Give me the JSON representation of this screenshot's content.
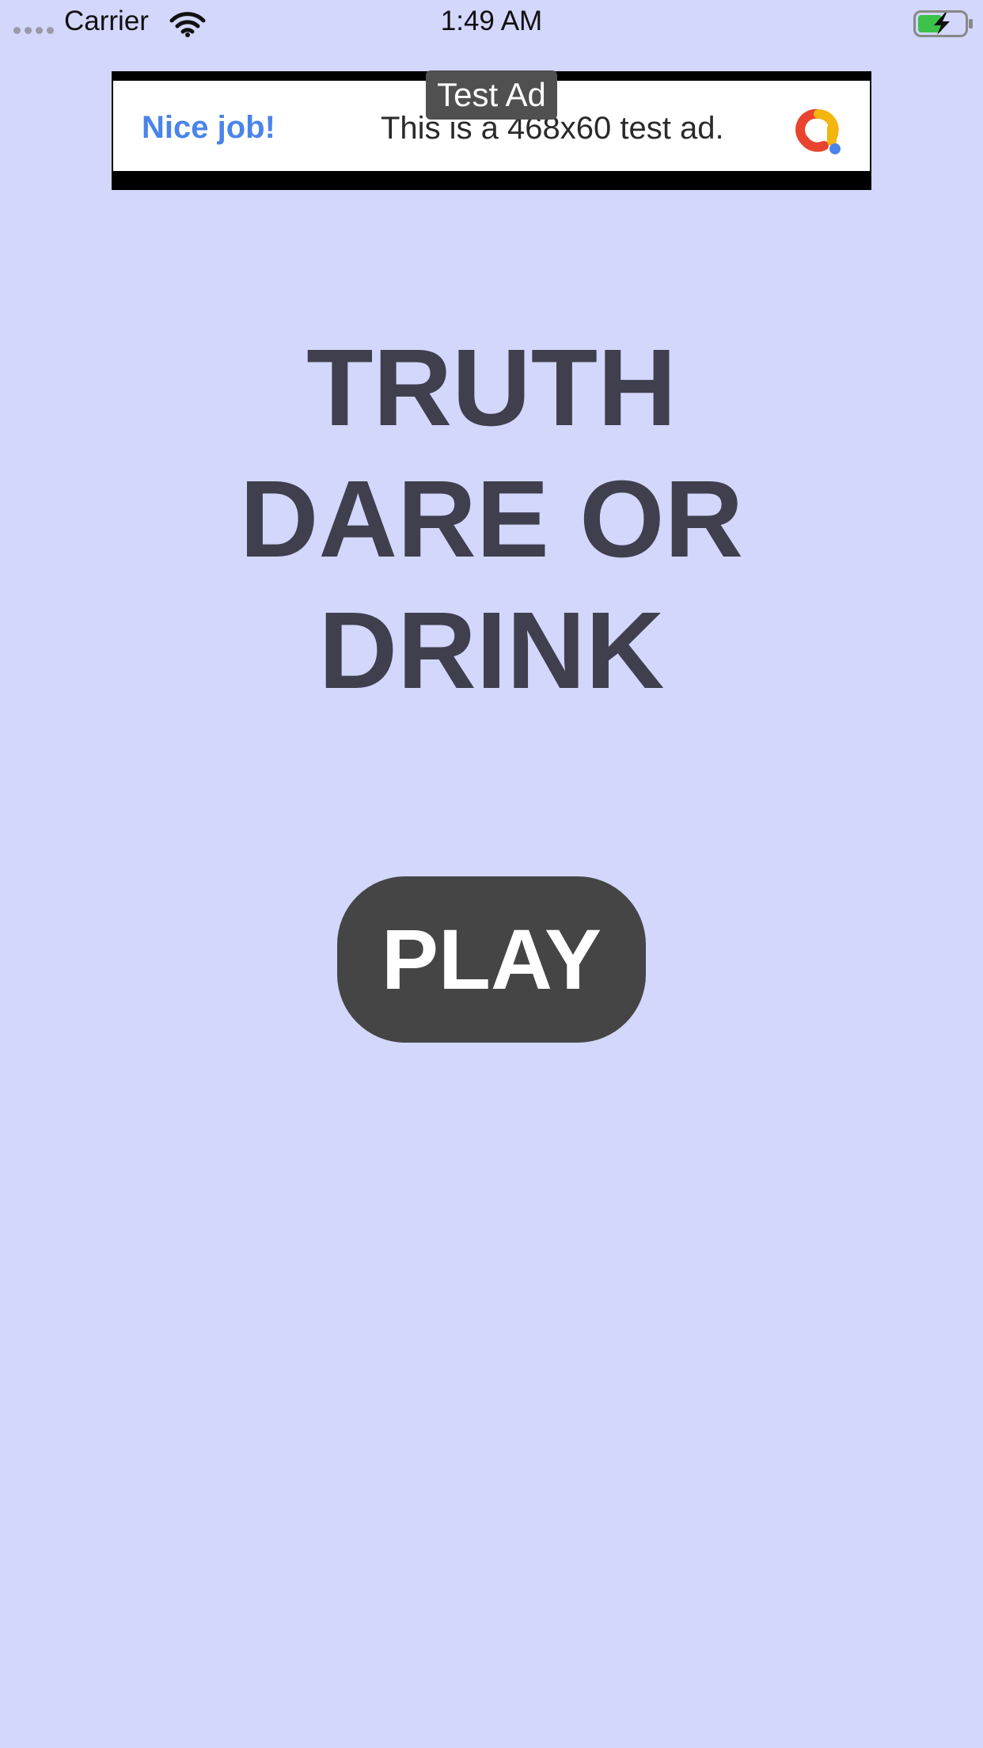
{
  "status_bar": {
    "carrier": "Carrier",
    "time": "1:49 AM",
    "signal_icon": "signal-dots-icon",
    "wifi_icon": "wifi-icon",
    "battery_icon": "battery-charging-icon"
  },
  "ad": {
    "label": "Test Ad",
    "headline": "Nice job!",
    "body": "This is a 468x60 test ad.",
    "logo_icon": "ad-network-logo-icon"
  },
  "title": {
    "line1": "TRUTH",
    "line2": "DARE OR",
    "line3": "DRINK"
  },
  "play_button": {
    "label": "PLAY"
  },
  "colors": {
    "background": "#d3d7fc",
    "title": "#3f3f4e",
    "button": "#454545",
    "ad_headline": "#4a84ea"
  }
}
